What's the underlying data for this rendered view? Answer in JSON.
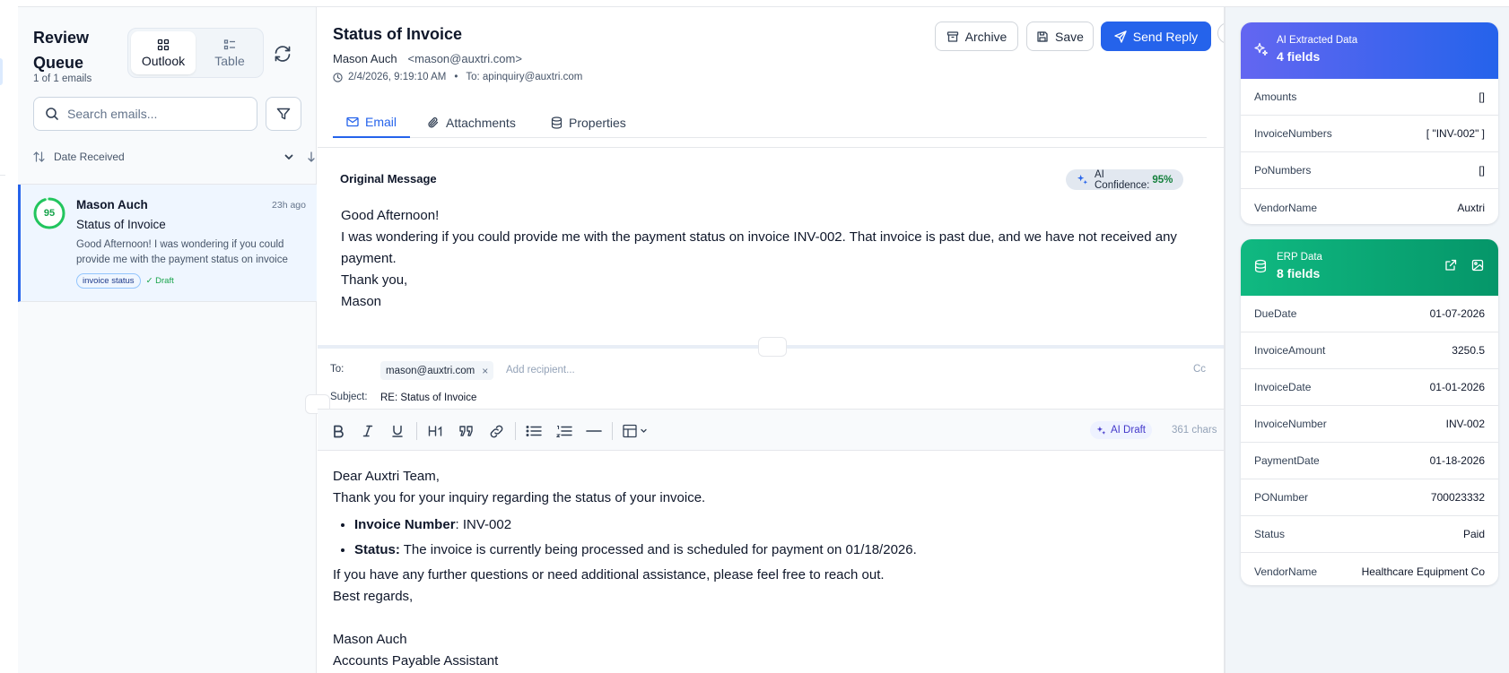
{
  "sidebar": {
    "title": "Review Queue",
    "count": "1 of 1 emails",
    "views": [
      "Outlook",
      "Table"
    ],
    "search_placeholder": "Search emails...",
    "sort_label": "Date Received",
    "emails": [
      {
        "score": "95",
        "score_fraction": 0.95,
        "sender": "Mason Auch",
        "time": "23h ago",
        "subject": "Status of Invoice",
        "preview": "Good Afternoon! I was wondering if you could provide me with the payment status on invoice INV-002. That invoice is past due, and we have not received any payment.",
        "tag": "invoice status",
        "status": "✓ Draft"
      }
    ]
  },
  "email": {
    "subject": "Status of Invoice",
    "from_name": "Mason Auch",
    "from_email": "<mason@auxtri.com>",
    "date": "2/4/2026, 9:19:10 AM",
    "to": "To: apinquiry@auxtri.com",
    "actions": {
      "archive": "Archive",
      "save": "Save",
      "send": "Send Reply"
    },
    "tabs": [
      "Email",
      "Attachments",
      "Properties"
    ],
    "original_label": "Original Message",
    "ai_confidence_label": "AI Confidence:",
    "ai_confidence_value": "95%",
    "body_lines": [
      "Good Afternoon!",
      "I was wondering if you could provide me with the payment status on invoice INV-002. That invoice is past due, and we have not received any payment.",
      "Thank you,",
      "Mason"
    ]
  },
  "reply": {
    "to_label": "To:",
    "recipient": "mason@auxtri.com",
    "add_placeholder": "Add recipient...",
    "cc": "Cc",
    "subject_label": "Subject:",
    "subject_value": "RE: Status of Invoice",
    "ai_draft": "AI Draft",
    "char_count": "361 chars",
    "greeting": "Dear Auxtri Team,",
    "intro": "Thank you for your inquiry regarding the status of your invoice.",
    "bullets": [
      {
        "label": "Invoice Number",
        "sep": ": ",
        "text": "INV-002"
      },
      {
        "label": "Status:",
        "sep": " ",
        "text": "The invoice is currently being processed and is scheduled for payment on 01/18/2026."
      }
    ],
    "closing": "If you have any further questions or need additional assistance, please feel free to reach out.",
    "signoff": "Best regards,",
    "sig_name": "Mason Auch",
    "sig_title": "Accounts Payable Assistant"
  },
  "ai_card": {
    "title": "AI Extracted Data",
    "count": "4 fields",
    "fields": [
      {
        "key": "Amounts",
        "value": "[]"
      },
      {
        "key": "InvoiceNumbers",
        "value": "[ \"INV-002\" ]"
      },
      {
        "key": "PoNumbers",
        "value": "[]"
      },
      {
        "key": "VendorName",
        "value": "Auxtri"
      }
    ]
  },
  "erp_card": {
    "title": "ERP Data",
    "count": "8 fields",
    "fields": [
      {
        "key": "DueDate",
        "value": "01-07-2026"
      },
      {
        "key": "InvoiceAmount",
        "value": "3250.5"
      },
      {
        "key": "InvoiceDate",
        "value": "01-01-2026"
      },
      {
        "key": "InvoiceNumber",
        "value": "INV-002"
      },
      {
        "key": "PaymentDate",
        "value": "01-18-2026"
      },
      {
        "key": "PONumber",
        "value": "700023332"
      },
      {
        "key": "Status",
        "value": "Paid"
      },
      {
        "key": "VendorName",
        "value": "Healthcare Equipment Co"
      }
    ]
  },
  "colors": {
    "accent": "#2563eb",
    "ai_gradient": [
      "#6366f1",
      "#2563eb"
    ],
    "erp_gradient": [
      "#10b981",
      "#059669"
    ],
    "score_green": "#16a34a"
  },
  "icons": [
    "grid-icon",
    "list-icon",
    "refresh-icon",
    "search-icon",
    "filter-icon",
    "sort-icon",
    "chevron-down-icon",
    "arrow-down-icon",
    "archive-icon",
    "save-icon",
    "send-icon",
    "chevron-right-icon",
    "mail-icon",
    "paperclip-icon",
    "database-icon",
    "clock-icon",
    "sparkle-icon",
    "bold-icon",
    "italic-icon",
    "underline-icon",
    "heading-icon",
    "quote-icon",
    "link-icon",
    "bullet-list-icon",
    "numbered-list-icon",
    "horizontal-rule-icon",
    "table-icon",
    "external-link-icon",
    "image-icon"
  ]
}
